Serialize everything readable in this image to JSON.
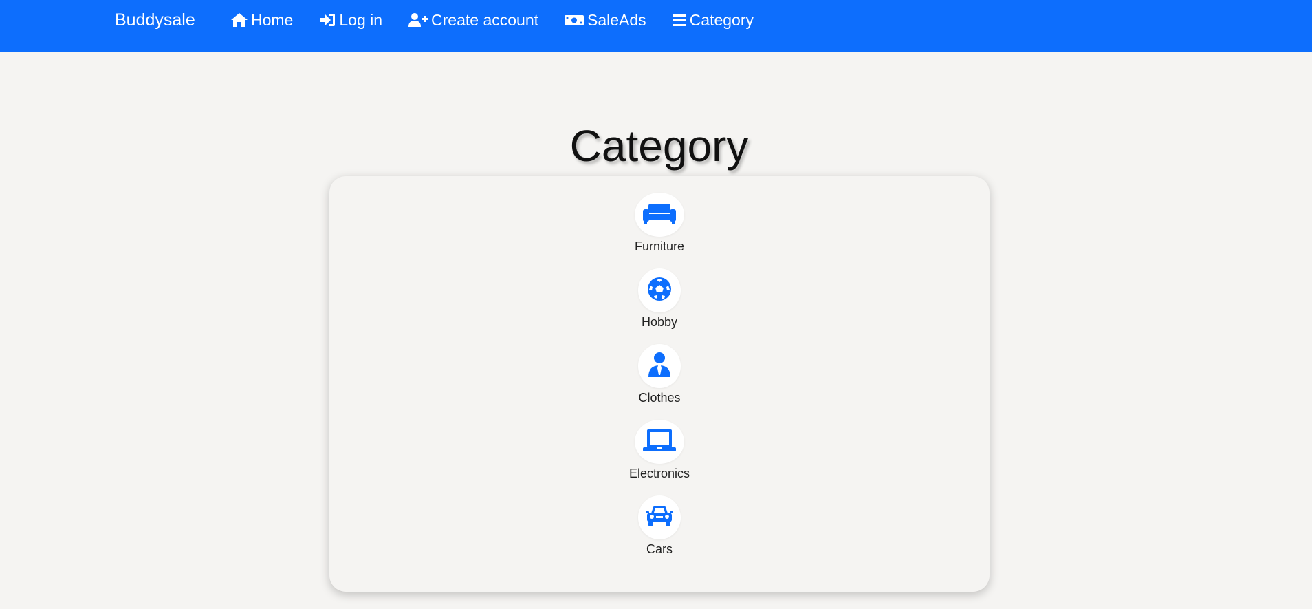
{
  "brand": "Buddysale",
  "colors": {
    "navbar": "#0d6efd",
    "background": "#f5f4f2",
    "icon": "#0d6efd"
  },
  "nav": [
    {
      "label": "Home",
      "icon": "home-icon"
    },
    {
      "label": "Log in",
      "icon": "sign-in-icon"
    },
    {
      "label": "Create account",
      "icon": "user-plus-icon"
    },
    {
      "label": "SaleAds",
      "icon": "money-bill-icon"
    },
    {
      "label": "Category",
      "icon": "bars-icon"
    }
  ],
  "page_title": "Category",
  "categories": [
    {
      "label": "Furniture",
      "icon": "couch-icon"
    },
    {
      "label": "Hobby",
      "icon": "soccer-ball-icon"
    },
    {
      "label": "Clothes",
      "icon": "user-tie-icon"
    },
    {
      "label": "Electronics",
      "icon": "laptop-icon"
    },
    {
      "label": "Cars",
      "icon": "car-icon"
    }
  ]
}
